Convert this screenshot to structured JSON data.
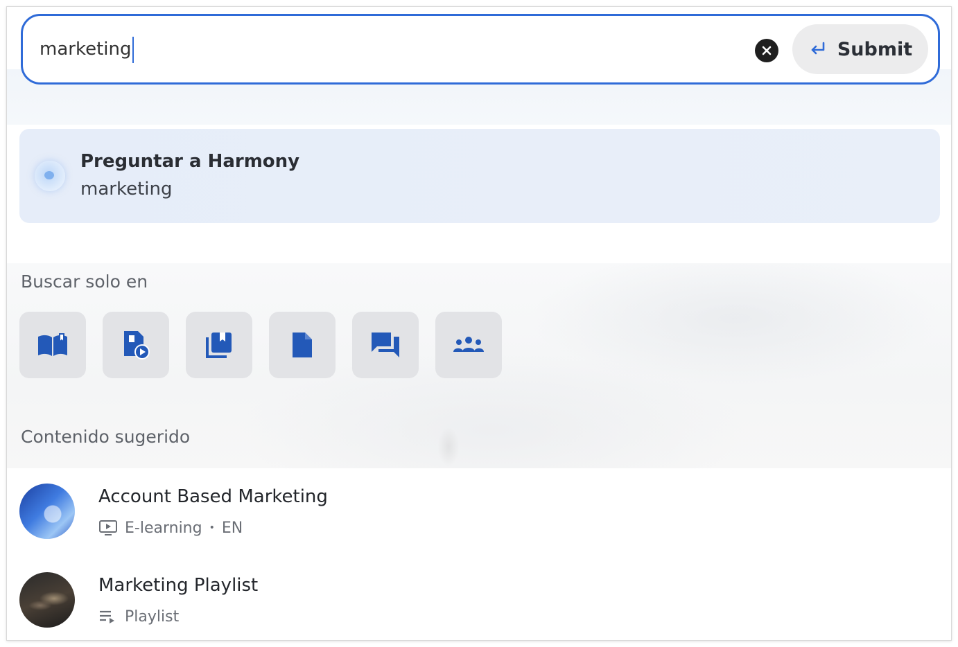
{
  "search": {
    "value": "marketing",
    "submit_label": "Submit",
    "accent_color": "#2f6bd8"
  },
  "harmony": {
    "title": "Preguntar a Harmony",
    "query": "marketing"
  },
  "filters": {
    "heading": "Buscar solo en",
    "items": [
      {
        "icon": "open-book-icon"
      },
      {
        "icon": "video-file-icon"
      },
      {
        "icon": "library-collection-icon"
      },
      {
        "icon": "document-icon"
      },
      {
        "icon": "forum-chat-icon"
      },
      {
        "icon": "community-group-icon"
      }
    ]
  },
  "suggested": {
    "heading": "Contenido sugerido",
    "items": [
      {
        "title": "Account Based Marketing",
        "type": "E-learning",
        "separator": "•",
        "language": "EN",
        "icon": "elearning-screen-icon"
      },
      {
        "title": "Marketing Playlist",
        "type": "Playlist",
        "icon": "playlist-icon"
      }
    ]
  }
}
